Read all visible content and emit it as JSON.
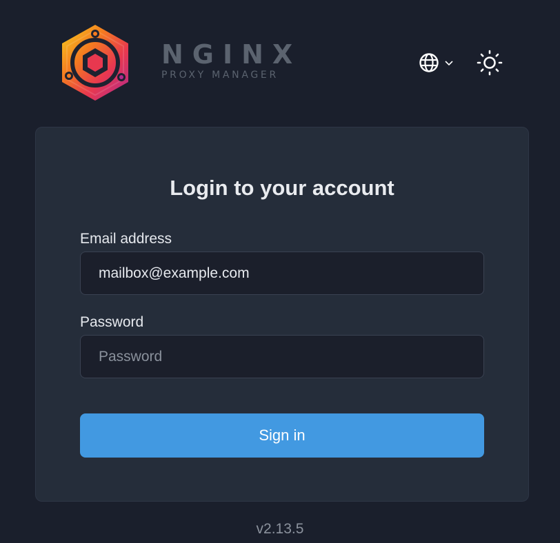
{
  "brand": {
    "name": "NGINX",
    "subtitle": "PROXY MANAGER"
  },
  "header": {
    "language_icon": "globe-icon",
    "language_chevron_icon": "chevron-down-icon",
    "theme_icon": "sun-icon"
  },
  "login": {
    "title": "Login to your account",
    "email": {
      "label": "Email address",
      "value": "mailbox@example.com",
      "placeholder": ""
    },
    "password": {
      "label": "Password",
      "value": "",
      "placeholder": "Password"
    },
    "submit_label": "Sign in"
  },
  "footer": {
    "version": "v2.13.5"
  },
  "colors": {
    "background": "#1a1f2c",
    "card": "#252d3a",
    "input_background": "#1b1f2b",
    "primary_button": "#4299e1",
    "wordmark": "#5b636f"
  }
}
